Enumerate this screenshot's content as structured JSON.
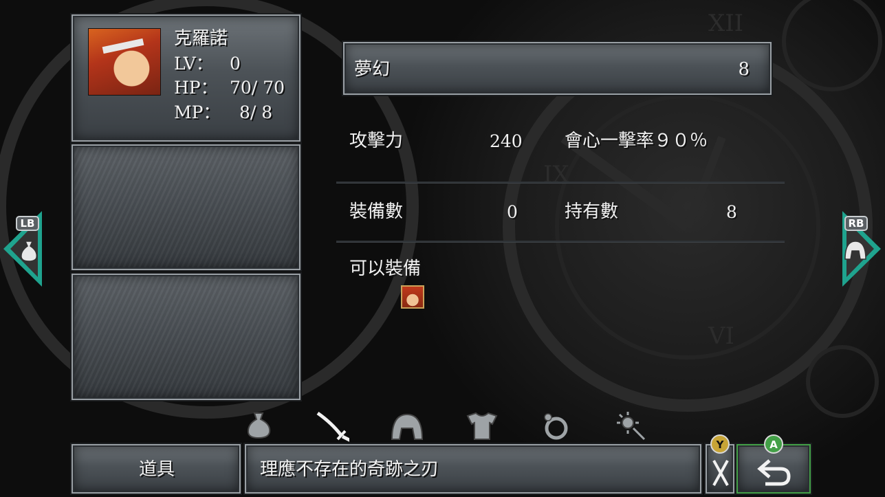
{
  "character": {
    "name": "克羅諾",
    "lv_label": "LV：",
    "lv_value": "0",
    "hp_label": "HP：",
    "hp_value": "70/  70",
    "mp_label": "MP：",
    "mp_value": "8/   8"
  },
  "item": {
    "name": "夢幻",
    "count": "8",
    "attack_label": "攻擊力",
    "attack_value": "240",
    "critical_label": "會心一擊率９０％",
    "equipped_label": "裝備數",
    "equipped_value": "0",
    "owned_label": "持有數",
    "owned_value": "8",
    "equippable_label": "可以裝備"
  },
  "nav": {
    "lb": "LB",
    "rb": "RB"
  },
  "tabs": [
    "bag-icon",
    "sword-icon",
    "helmet-icon",
    "armor-icon",
    "ring-icon",
    "accessory-icon"
  ],
  "bottom": {
    "category": "道具",
    "description": "理應不存在的奇跡之刃",
    "y_label": "Y",
    "a_label": "A"
  },
  "colors": {
    "accent_teal": "#1fa38e",
    "y_button": "#c7a436",
    "a_button": "#43a047"
  }
}
